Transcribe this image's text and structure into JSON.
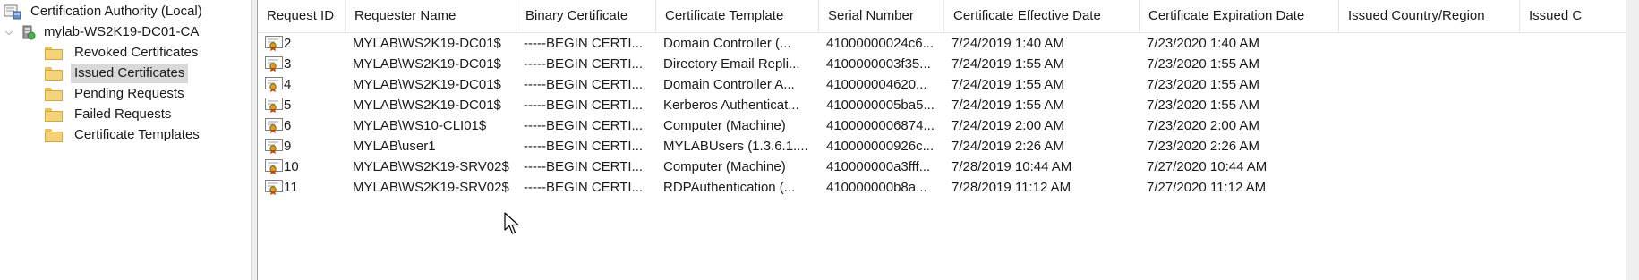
{
  "tree": {
    "root_label": "Certification Authority (Local)",
    "ca_label": "mylab-WS2K19-DC01-CA",
    "items": [
      {
        "label": "Revoked Certificates",
        "selected": false
      },
      {
        "label": "Issued Certificates",
        "selected": true
      },
      {
        "label": "Pending Requests",
        "selected": false
      },
      {
        "label": "Failed Requests",
        "selected": false
      },
      {
        "label": "Certificate Templates",
        "selected": false
      }
    ]
  },
  "columns": [
    "Request ID",
    "Requester Name",
    "Binary Certificate",
    "Certificate Template",
    "Serial Number",
    "Certificate Effective Date",
    "Certificate Expiration Date",
    "Issued Country/Region",
    "Issued C"
  ],
  "rows": [
    {
      "id": "2",
      "requester": "MYLAB\\WS2K19-DC01$",
      "binary": "-----BEGIN CERTI...",
      "template": "Domain Controller (...",
      "serial": "41000000024c6...",
      "effective": "7/24/2019 1:40 AM",
      "expiration": "7/23/2020 1:40 AM"
    },
    {
      "id": "3",
      "requester": "MYLAB\\WS2K19-DC01$",
      "binary": "-----BEGIN CERTI...",
      "template": "Directory Email Repli...",
      "serial": "4100000003f35...",
      "effective": "7/24/2019 1:55 AM",
      "expiration": "7/23/2020 1:55 AM"
    },
    {
      "id": "4",
      "requester": "MYLAB\\WS2K19-DC01$",
      "binary": "-----BEGIN CERTI...",
      "template": "Domain Controller A...",
      "serial": "410000004620...",
      "effective": "7/24/2019 1:55 AM",
      "expiration": "7/23/2020 1:55 AM"
    },
    {
      "id": "5",
      "requester": "MYLAB\\WS2K19-DC01$",
      "binary": "-----BEGIN CERTI...",
      "template": "Kerberos Authenticat...",
      "serial": "4100000005ba5...",
      "effective": "7/24/2019 1:55 AM",
      "expiration": "7/23/2020 1:55 AM"
    },
    {
      "id": "6",
      "requester": "MYLAB\\WS10-CLI01$",
      "binary": "-----BEGIN CERTI...",
      "template": "Computer (Machine)",
      "serial": "4100000006874...",
      "effective": "7/24/2019 2:00 AM",
      "expiration": "7/23/2020 2:00 AM"
    },
    {
      "id": "9",
      "requester": "MYLAB\\user1",
      "binary": "-----BEGIN CERTI...",
      "template": "MYLABUsers (1.3.6.1....",
      "serial": "410000000926c...",
      "effective": "7/24/2019 2:26 AM",
      "expiration": "7/23/2020 2:26 AM"
    },
    {
      "id": "10",
      "requester": "MYLAB\\WS2K19-SRV02$",
      "binary": "-----BEGIN CERTI...",
      "template": "Computer (Machine)",
      "serial": "410000000a3fff...",
      "effective": "7/28/2019 10:44 AM",
      "expiration": "7/27/2020 10:44 AM"
    },
    {
      "id": "11",
      "requester": "MYLAB\\WS2K19-SRV02$",
      "binary": "-----BEGIN CERTI...",
      "template": "RDPAuthentication (...",
      "serial": "410000000b8a...",
      "effective": "7/28/2019 11:12 AM",
      "expiration": "7/27/2020 11:12 AM"
    }
  ],
  "icons": {
    "tree_root": "certificate-authority-icon",
    "tree_ca": "ca-server-icon",
    "tree_folder": "folder-icon",
    "row": "certificate-icon"
  },
  "colors": {
    "selection": "#d9d9d9",
    "folder": "#f3d27a",
    "cert_ribbon": "#d6a21e"
  }
}
